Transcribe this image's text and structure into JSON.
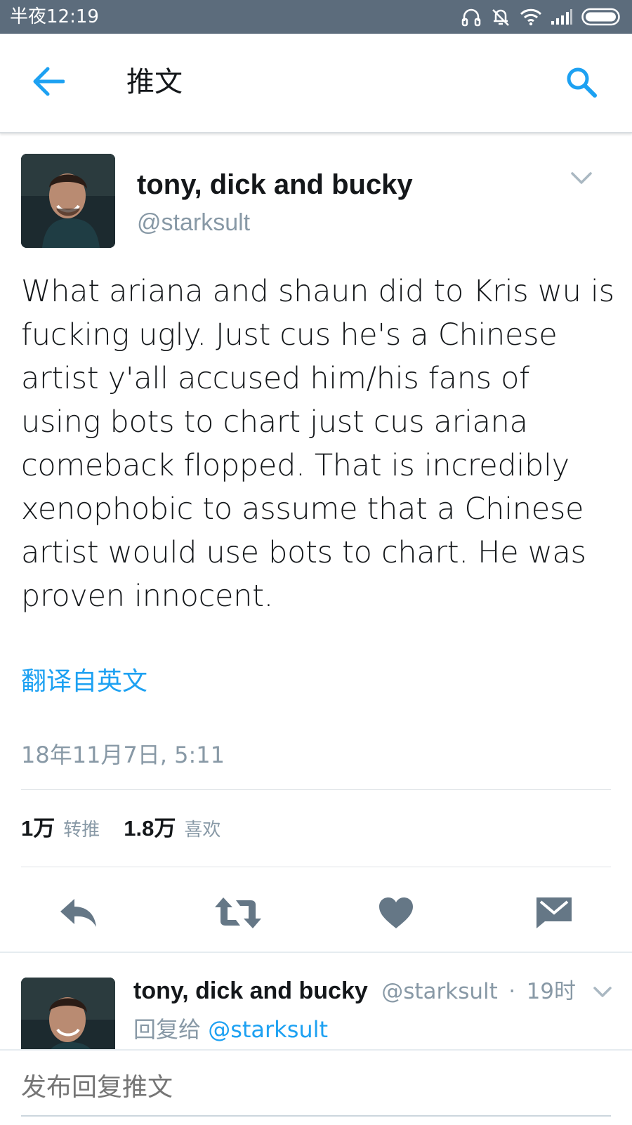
{
  "status_bar": {
    "time": "半夜12:19",
    "icons": [
      "headphones-icon",
      "mute-icon",
      "wifi-icon",
      "signal-icon",
      "battery-icon"
    ],
    "background": "#5c6c7c"
  },
  "app_bar": {
    "title": "推文",
    "back_icon": "arrow-left-icon",
    "search_icon": "search-icon",
    "accent": "#1da1f2"
  },
  "tweet": {
    "display_name": "tony, dick and bucky",
    "handle": "@starksult",
    "text": "What ariana and shaun did to Kris wu is fucking ugly. Just cus he's a Chinese artist y'all accused him/his fans of using bots to chart just cus ariana comeback flopped. That is incredibly xenophobic to assume that a Chinese artist would use bots to chart. He was proven innocent.",
    "translate_label": "翻译自英文",
    "timestamp": "18年11月7日, 5:11",
    "retweets_count": "1万",
    "retweets_label": "转推",
    "likes_count": "1.8万",
    "likes_label": "喜欢"
  },
  "actions": [
    {
      "name": "reply",
      "icon": "reply-icon"
    },
    {
      "name": "retweet",
      "icon": "retweet-icon"
    },
    {
      "name": "like",
      "icon": "heart-icon"
    },
    {
      "name": "message",
      "icon": "envelope-icon"
    }
  ],
  "reply": {
    "display_name": "tony, dick and bucky",
    "handle": "@starksult",
    "separator": "·",
    "time_ago": "19时",
    "replying_to_label": "回复给",
    "replying_to_handle": "@starksult"
  },
  "compose": {
    "placeholder": "发布回复推文"
  },
  "colors": {
    "text": "#14171a",
    "secondary": "#8899a6",
    "icon": "#657786",
    "link": "#1da1f2"
  }
}
